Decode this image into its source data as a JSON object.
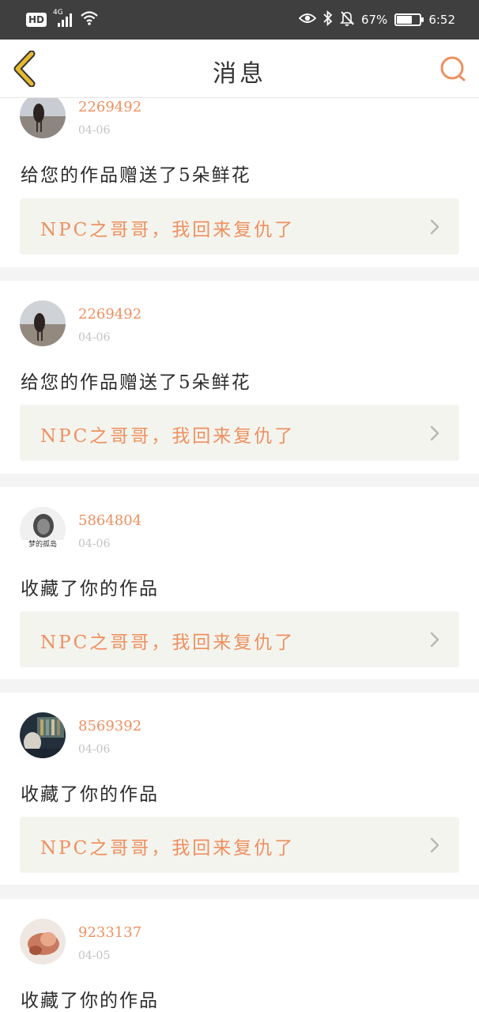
{
  "status_bar": {
    "hd": "HD",
    "network": "4G",
    "battery_percent": "67%",
    "battery_level": 0.67,
    "time": "6:52"
  },
  "header": {
    "title": "消息",
    "back_icon": "chevron-left-icon",
    "search_icon": "search-icon"
  },
  "colors": {
    "accent": "#ee9060",
    "back_arrow": "#e7b92f",
    "card_bg": "#f4f4ee",
    "separator": "#f4f4f4"
  },
  "messages": [
    {
      "username": "2269492",
      "date": "04-06",
      "action": "给您的作品赠送了5朵鲜花",
      "work_title": "NPC之哥哥，我回来复仇了"
    },
    {
      "username": "2269492",
      "date": "04-06",
      "action": "给您的作品赠送了5朵鲜花",
      "work_title": "NPC之哥哥，我回来复仇了"
    },
    {
      "username": "5864804",
      "date": "04-06",
      "avatar_caption": "梦的孤岛",
      "action": "收藏了你的作品",
      "work_title": "NPC之哥哥，我回来复仇了"
    },
    {
      "username": "8569392",
      "date": "04-06",
      "action": "收藏了你的作品",
      "work_title": "NPC之哥哥，我回来复仇了"
    },
    {
      "username": "9233137",
      "date": "04-05",
      "action": "收藏了你的作品"
    }
  ]
}
